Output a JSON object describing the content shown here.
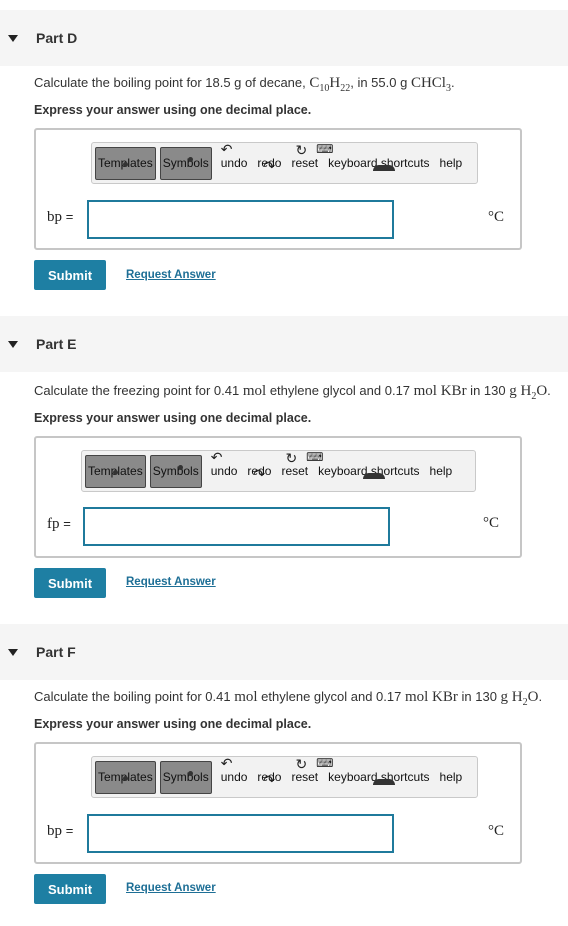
{
  "common": {
    "instruction": "Express your answer using one decimal place.",
    "submit": "Submit",
    "request_answer": "Request Answer",
    "toolbar": {
      "templates": "Templates",
      "symbols": "Symbols",
      "undo": "undo",
      "redo": "redo",
      "reset": "reset",
      "keyboard_shortcuts": "keyboard shortcuts",
      "help": "help"
    },
    "unit": "°C",
    "equals": "="
  },
  "partD": {
    "title": "Part D",
    "q_prefix": "Calculate the boiling point for 18.5 g of decane, ",
    "q_formula_main": "C",
    "q_sub1": "10",
    "q_formula_h": "H",
    "q_sub2": "22",
    "q_mid": ", in 55.0 g ",
    "q_solvent": "CHCl",
    "q_sub3": "3",
    "q_end": ".",
    "var": "bp",
    "value": ""
  },
  "partE": {
    "title": "Part E",
    "q_prefix": "Calculate the freezing point for 0.41 ",
    "q_mol1": "mol",
    "q_mid1": " ethylene glycol and 0.17 ",
    "q_mol2": "mol KBr",
    "q_mid2": " in 130 ",
    "q_g": "g H",
    "q_sub": "2",
    "q_o": "O",
    "q_end": ".",
    "var": "fp",
    "value": ""
  },
  "partF": {
    "title": "Part F",
    "q_prefix": "Calculate the boiling point for 0.41 ",
    "q_mol1": "mol",
    "q_mid1": " ethylene glycol and 0.17 ",
    "q_mol2": "mol KBr",
    "q_mid2": " in 130 ",
    "q_g": "g H",
    "q_sub": "2",
    "q_o": "O",
    "q_end": ".",
    "var": "bp",
    "value": ""
  }
}
